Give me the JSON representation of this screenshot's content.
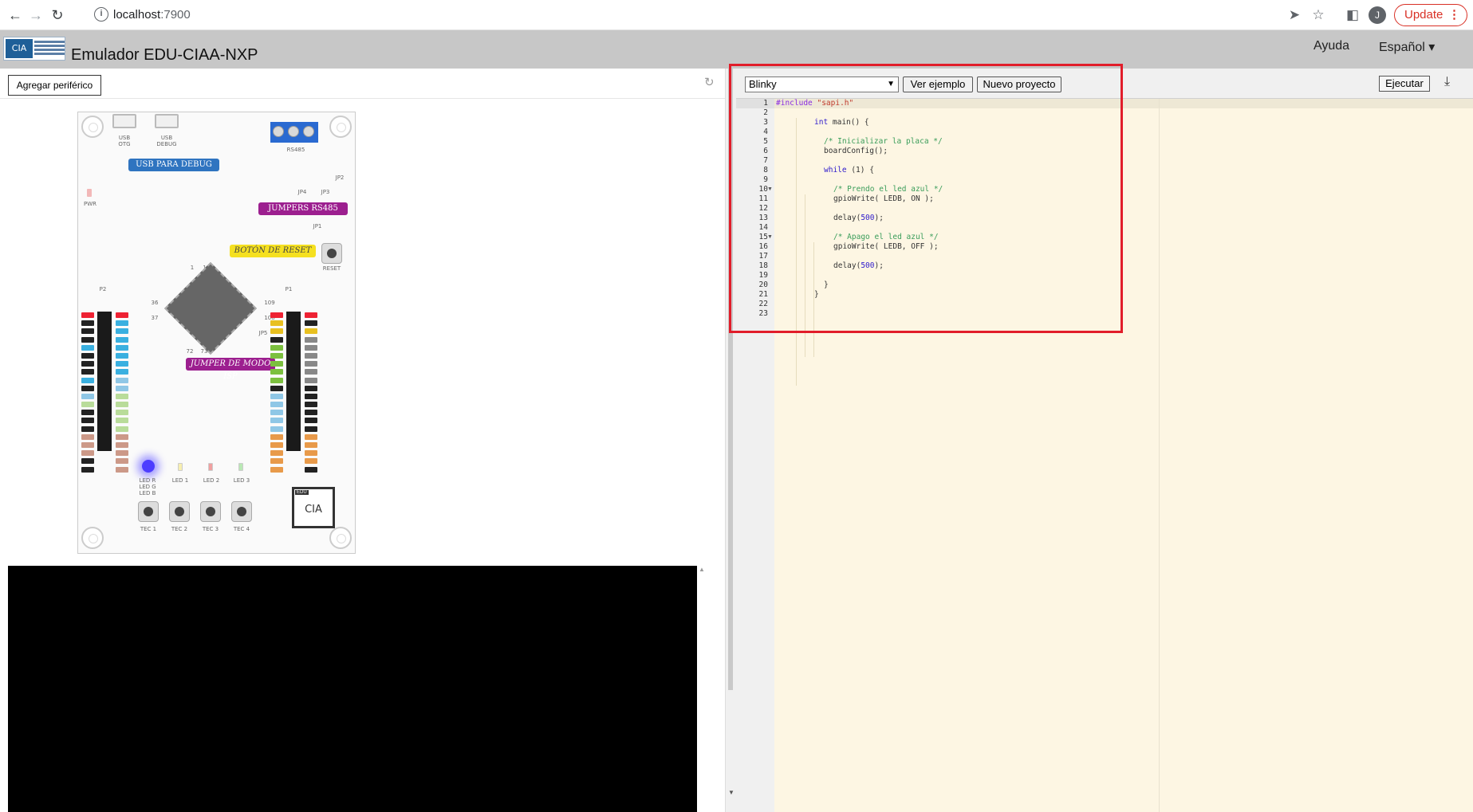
{
  "browser": {
    "url_host": "localhost",
    "url_port": ":7900",
    "avatar_initial": "J",
    "update_label": "Update"
  },
  "header": {
    "title": "Emulador EDU-CIAA-NXP",
    "logo_text": "CIA",
    "help_label": "Ayuda",
    "lang_label": "Español ▾"
  },
  "left": {
    "add_peripheral_label": "Agregar periférico",
    "board": {
      "usb_otg": "USB\nOTG",
      "usb_debug": "USB\nDEBUG",
      "rs485": "RS485",
      "usb_debug_callout": "USB PARA DEBUG",
      "jumpers_callout": "JUMPERS RS485",
      "reset_callout": "BOTÓN DE RESET",
      "isp_callout": "JUMPER DE MODO ISP",
      "pwr": "PWR",
      "reset": "RESET",
      "jp1": "JP1",
      "jp2": "JP2",
      "jp3": "JP3",
      "jp4": "JP4",
      "jp5": "JP5",
      "p1": "P1",
      "p2": "P2",
      "pin_1": "1",
      "pin_144": "144",
      "pin_36": "36",
      "pin_37": "37",
      "pin_109": "109",
      "pin_108": "108",
      "pin_72": "72",
      "pin_73": "73",
      "led_rgb": "LED R\nLED G\nLED B",
      "led1": "LED 1",
      "led2": "LED 2",
      "led3": "LED 3",
      "tec1": "TEC 1",
      "tec2": "TEC 2",
      "tec3": "TEC 3",
      "tec4": "TEC 4",
      "edu_logo": "CIA",
      "edu_tag": "EDU"
    }
  },
  "editor": {
    "example_selected": "Blinky",
    "view_example_label": "Ver ejemplo",
    "new_project_label": "Nuevo proyecto",
    "run_label": "Ejecutar",
    "line_numbers": [
      "1",
      "2",
      "3",
      "4",
      "5",
      "6",
      "7",
      "8",
      "9",
      "10",
      "11",
      "12",
      "13",
      "14",
      "15",
      "16",
      "17",
      "18",
      "19",
      "20",
      "21",
      "22",
      "23"
    ],
    "code": {
      "l1_pre": "#include ",
      "l1_str": "\"sapi.h\"",
      "l3_kw": "int",
      "l3_rest": " main() {",
      "l5_com": "/* Inicializar la placa */",
      "l6": "boardConfig();",
      "l8_kw": "while",
      "l8_rest": " (1) {",
      "l10_com": "/* Prendo el led azul */",
      "l11": "gpioWrite( LEDB, ON );",
      "l13_a": "delay(",
      "l13_num": "500",
      "l13_b": ");",
      "l15_com": "/* Apago el led azul */",
      "l16": "gpioWrite( LEDB, OFF );",
      "l18_a": "delay(",
      "l18_num": "500",
      "l18_b": ");",
      "l20": "}",
      "l21": "}"
    }
  },
  "colors": {
    "highlight": "#e11d2a",
    "editor_bg": "#fdf6e3",
    "rs485_blue": "#2a6ad1",
    "callout_purple": "#9c1f8f",
    "callout_yellow": "#f5e020",
    "callout_blue": "#2f74c0"
  }
}
